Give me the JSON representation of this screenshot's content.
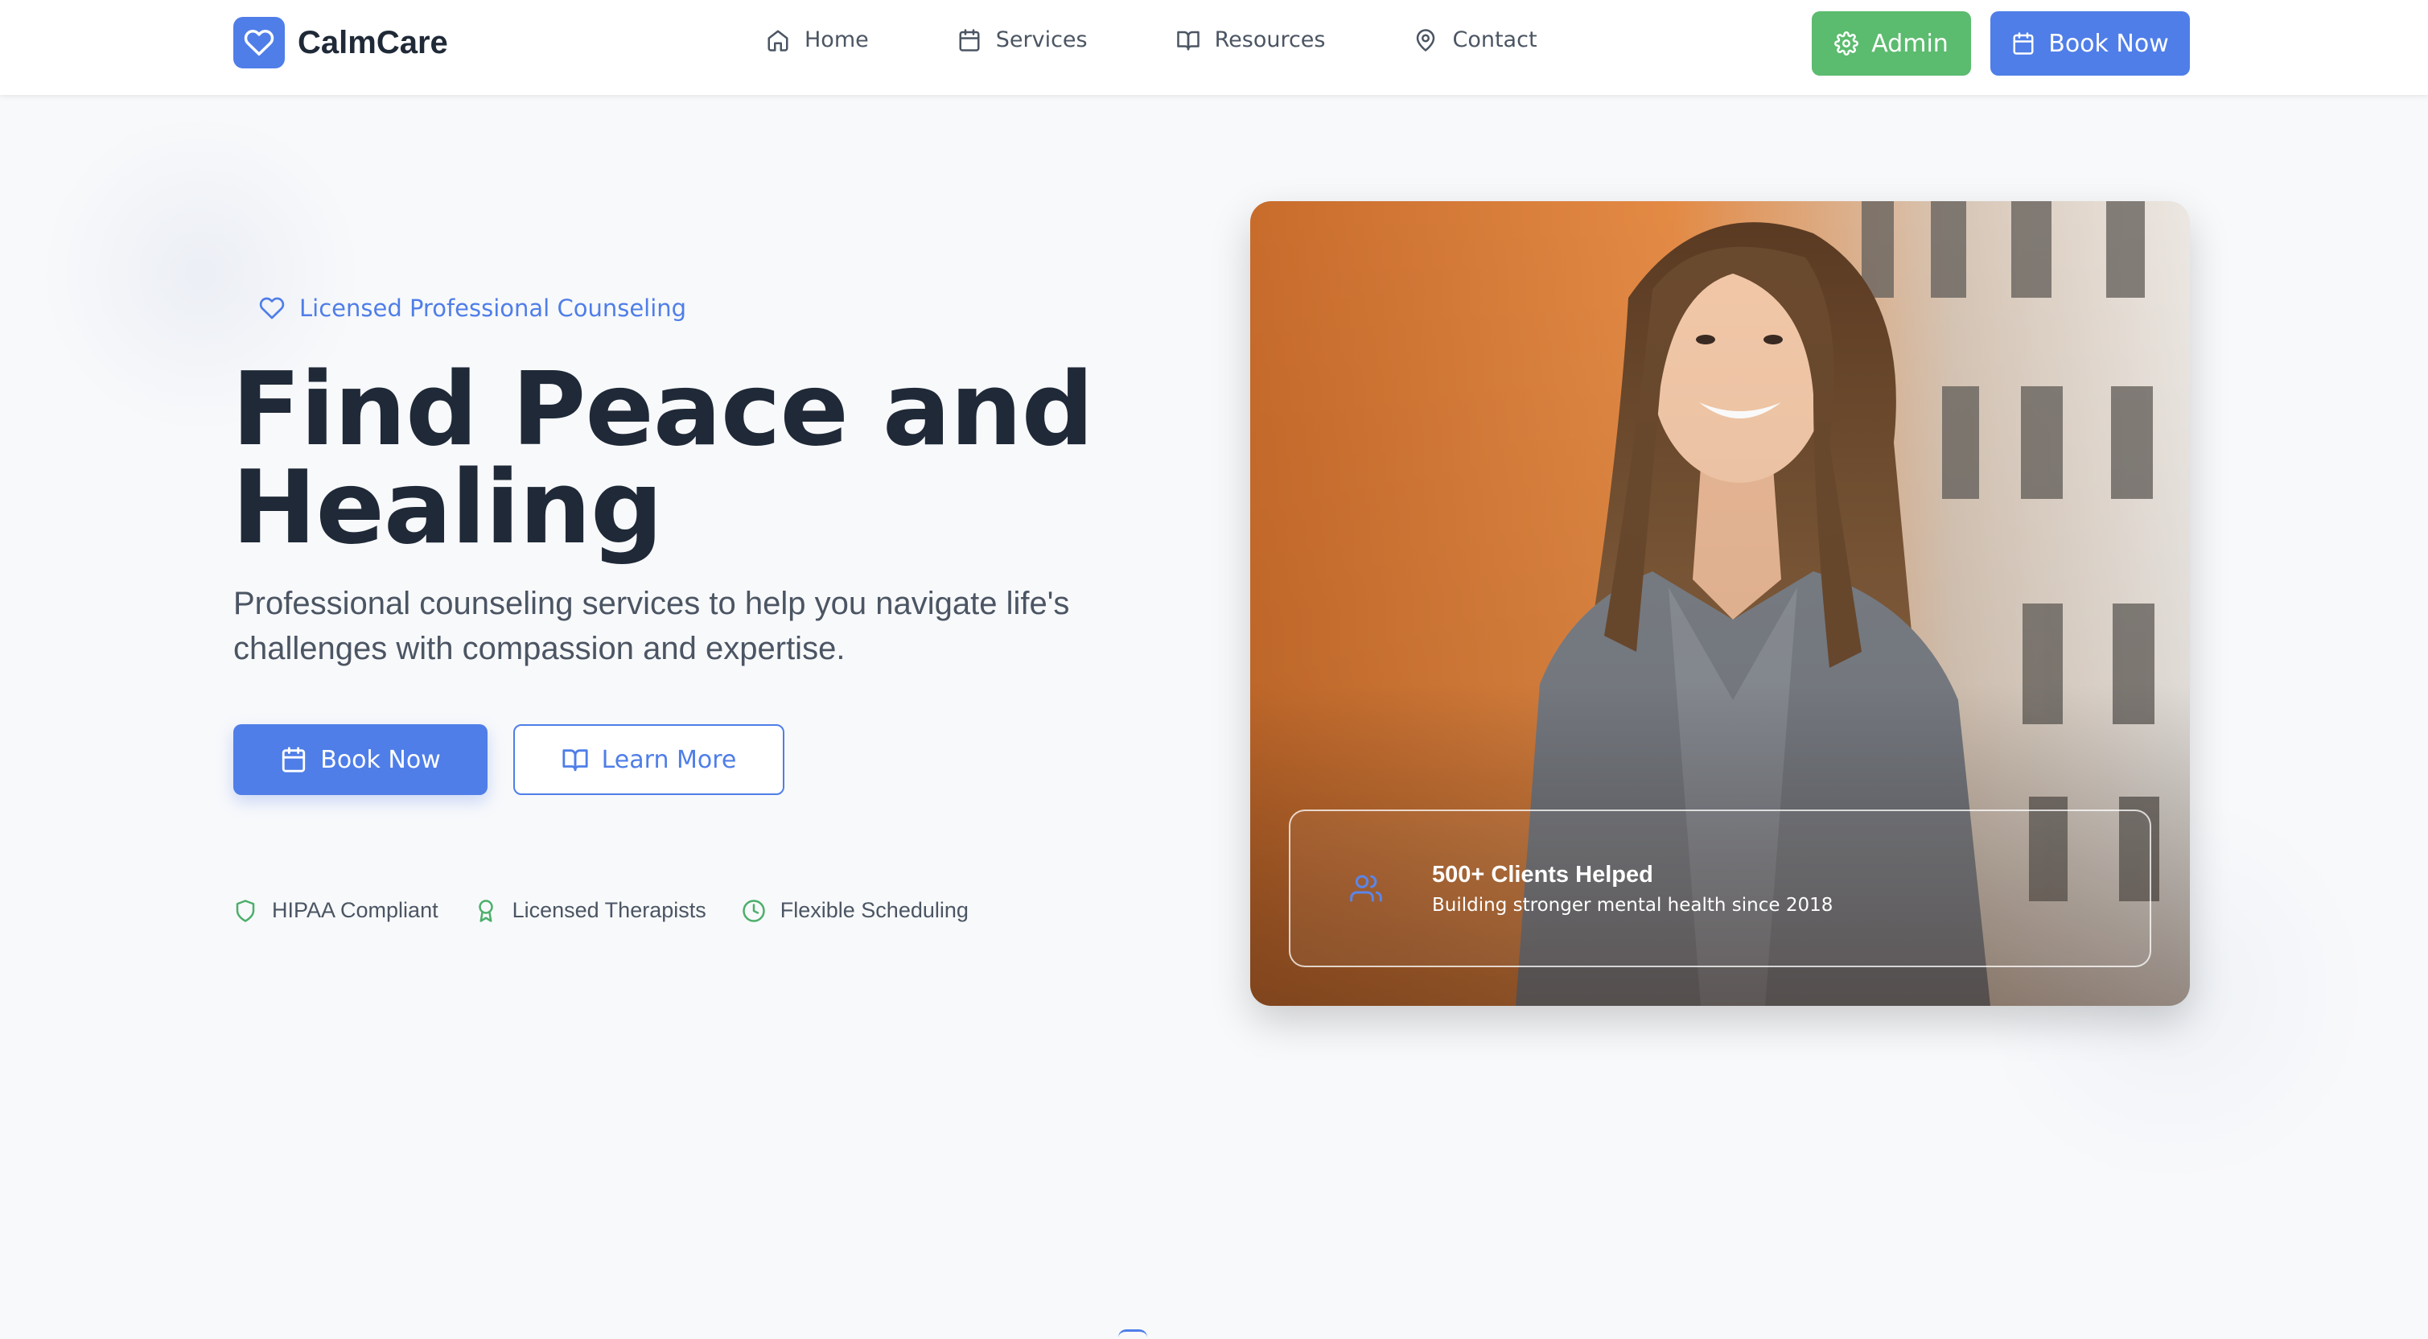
{
  "header": {
    "brand": "CalmCare",
    "nav": [
      {
        "label": "Home",
        "icon": "home-icon"
      },
      {
        "label": "Services",
        "icon": "calendar-icon"
      },
      {
        "label": "Resources",
        "icon": "book-open-icon"
      },
      {
        "label": "Contact",
        "icon": "map-pin-icon"
      }
    ],
    "admin_label": "Admin",
    "book_label": "Book Now"
  },
  "hero": {
    "badge": "Licensed Professional Counseling",
    "title": "Find Peace and Healing",
    "subtitle": "Professional counseling services to help you navigate life's challenges with compassion and expertise.",
    "primary_cta": "Book Now",
    "secondary_cta": "Learn More",
    "features": [
      {
        "label": "HIPAA Compliant",
        "icon": "shield-icon"
      },
      {
        "label": "Licensed Therapists",
        "icon": "award-icon"
      },
      {
        "label": "Flexible Scheduling",
        "icon": "clock-icon"
      }
    ]
  },
  "stat_card": {
    "title": "500+ Clients Helped",
    "description": "Building stronger mental health since 2018",
    "icon": "users-icon"
  },
  "colors": {
    "primary": "#4f7ee8",
    "success": "#5bbb6e",
    "text_dark": "#1f2937",
    "text_muted": "#4b5563",
    "background": "#f8f9fb"
  }
}
